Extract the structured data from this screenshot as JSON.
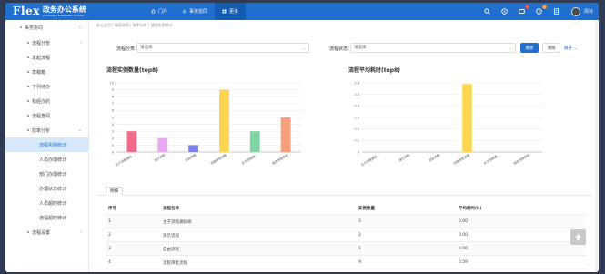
{
  "app": {
    "logo": "Flex",
    "title": "政务办公系统",
    "subtitle": "ZHENGWU BANGONG XITONG"
  },
  "topnav": [
    {
      "label": "门户",
      "icon": "home-icon",
      "active": false
    },
    {
      "label": "事务协同",
      "icon": "sync-icon",
      "active": false
    },
    {
      "label": "更多",
      "icon": "grid-icon",
      "active": true
    }
  ],
  "header_icons": {
    "messages_badge": "7",
    "tasks_badge": "8",
    "username": "风铃"
  },
  "sidebar": {
    "group": "事务协同",
    "items": [
      {
        "label": "流程分管",
        "arrow": "›"
      },
      {
        "label": "发起流程",
        "arrow": ""
      },
      {
        "label": "草稿箱",
        "arrow": ""
      },
      {
        "label": "下列待办",
        "arrow": ""
      },
      {
        "label": "我经办的",
        "arrow": ""
      },
      {
        "label": "流程查阅",
        "arrow": ""
      },
      {
        "label": "效率分析",
        "arrow": "⌄"
      }
    ],
    "sub_items": [
      {
        "label": "流程实例统计",
        "active": true
      },
      {
        "label": "人员办理统计",
        "active": false
      },
      {
        "label": "部门办理统计",
        "active": false
      },
      {
        "label": "办理状态统计",
        "active": false
      },
      {
        "label": "人员超时统计",
        "active": false
      },
      {
        "label": "流程超时统计",
        "active": false
      }
    ],
    "footer_item": {
      "label": "流程设置",
      "arrow": "›"
    }
  },
  "breadcrumb": "办公主页 / 事务协同 / 效率分析 / 流程实例统计",
  "filters": {
    "category_label": "流程分类：",
    "category_value": "请选择",
    "status_label": "流程状态：",
    "status_value": "请选择",
    "search_button": "搜索",
    "clear_button": "清除",
    "expand_link": "展开 ⌄"
  },
  "colors": {
    "primary": "#1f6fcf",
    "bar_yellow": "#ffd54f"
  },
  "chart_data": [
    {
      "type": "bar",
      "title": "流程实例数量(top8)",
      "categories": [
        "主子流程通知...",
        "演示流程",
        "自由流程",
        "流程审批流程",
        "主子流程通...",
        "固定流程审批"
      ],
      "values": [
        3,
        2,
        1,
        9,
        3,
        5
      ],
      "colors": [
        "#f26b8a",
        "#e9a8f0",
        "#7b83eb",
        "#ffd54f",
        "#7ed6a3",
        "#f9a07a"
      ],
      "ylim": [
        0,
        10
      ],
      "yticks": [
        "0",
        "1",
        "2",
        "3",
        "4",
        "5",
        "6",
        "7",
        "8",
        "9",
        "10"
      ],
      "xlabel": "",
      "ylabel": "",
      "grid": true
    },
    {
      "type": "bar",
      "title": "流程平均耗时(top8)",
      "categories": [
        "主子流程通知...",
        "演示流程",
        "自由流程",
        "流程审批流程",
        "主子流程通...",
        "固定流程审批"
      ],
      "values": [
        0,
        0,
        0,
        0.59,
        0,
        0
      ],
      "colors": [
        "#f26b8a",
        "#e9a8f0",
        "#7b83eb",
        "#ffd54f",
        "#7ed6a3",
        "#f9a07a"
      ],
      "ylim": [
        0,
        0.6
      ],
      "yticks": [
        "0",
        "0.1",
        "0.2",
        "0.3",
        "0.4",
        "0.5",
        "0.6"
      ],
      "xlabel": "",
      "ylabel": "",
      "grid": true
    }
  ],
  "tab": {
    "label": "明细"
  },
  "table": {
    "headers": [
      "序号",
      "流程名称",
      "实例数量",
      "平均耗时(h)"
    ],
    "rows": [
      [
        "1",
        "主子流程通知阅",
        "3",
        "0.00"
      ],
      [
        "2",
        "演示流程",
        "2",
        "0.00"
      ],
      [
        "3",
        "自由流程",
        "1",
        "0.00"
      ],
      [
        "4",
        "流程审批流程",
        "9",
        "0.59"
      ]
    ]
  }
}
